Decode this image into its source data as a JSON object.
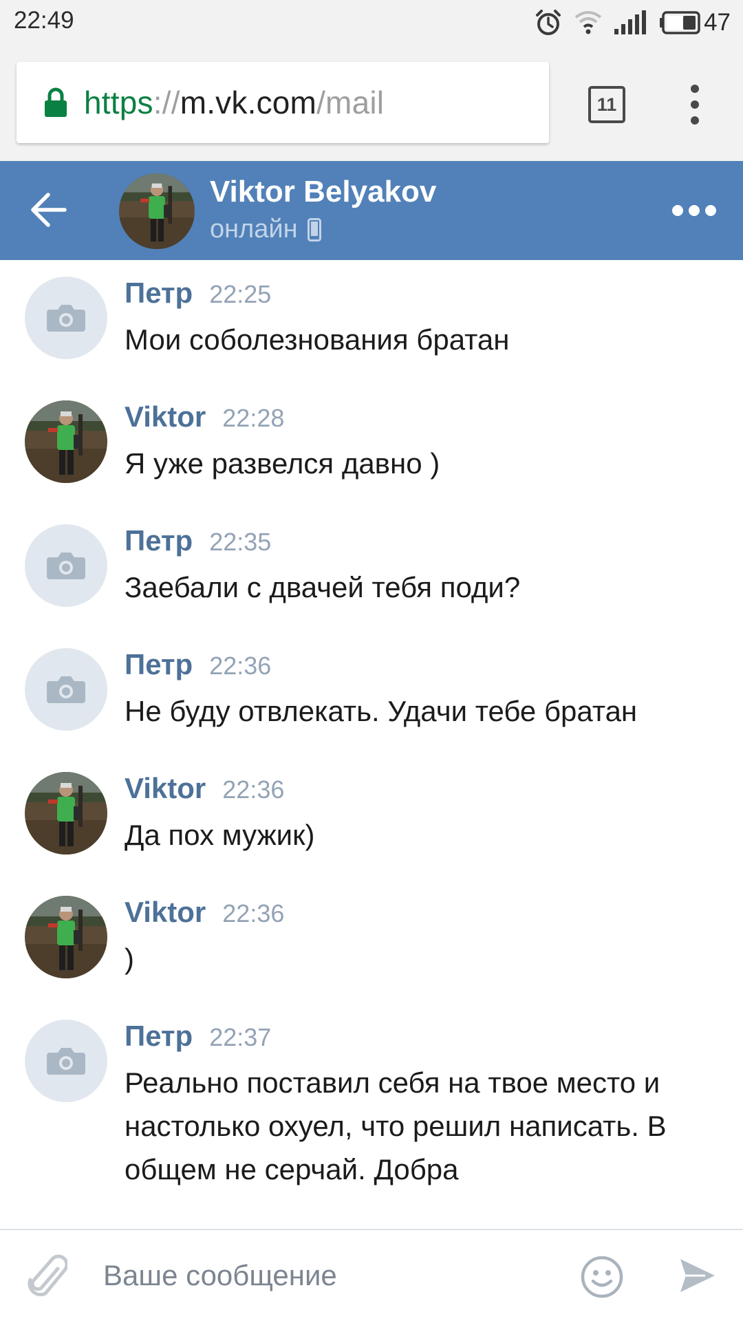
{
  "status_bar": {
    "time": "22:49",
    "battery": "47",
    "icons": [
      "alarm-icon",
      "wifi-icon",
      "signal-icon",
      "battery-icon"
    ]
  },
  "browser": {
    "url_scheme": "https",
    "url_separator": "://",
    "url_host": "m.vk.com",
    "url_path": "/mail",
    "tab_count": "11",
    "lock_color": "#0b8043"
  },
  "chat_header": {
    "name": "Viktor Belyakov",
    "status": "онлайн",
    "accent_color": "#5181b8"
  },
  "messages": [
    {
      "author": "Петр",
      "time": "22:25",
      "text": "Мои соболезнования братан",
      "avatar": "placeholder"
    },
    {
      "author": "Viktor",
      "time": "22:28",
      "text": "Я уже развелся давно )",
      "avatar": "photo"
    },
    {
      "author": "Петр",
      "time": "22:35",
      "text": "Заебали с двачей тебя поди?",
      "avatar": "placeholder"
    },
    {
      "author": "Петр",
      "time": "22:36",
      "text": "Не буду отвлекать. Удачи тебе братан",
      "avatar": "placeholder"
    },
    {
      "author": "Viktor",
      "time": "22:36",
      "text": "Да пох мужик)",
      "avatar": "photo"
    },
    {
      "author": "Viktor",
      "time": "22:36",
      "text": ")",
      "avatar": "photo"
    },
    {
      "author": "Петр",
      "time": "22:37",
      "text": "Реально поставил себя на твое место и настолько охуел, что решил написать. В общем не серчай. Добра",
      "avatar": "placeholder"
    }
  ],
  "composer": {
    "value": "",
    "placeholder": "Ваше сообщение"
  }
}
